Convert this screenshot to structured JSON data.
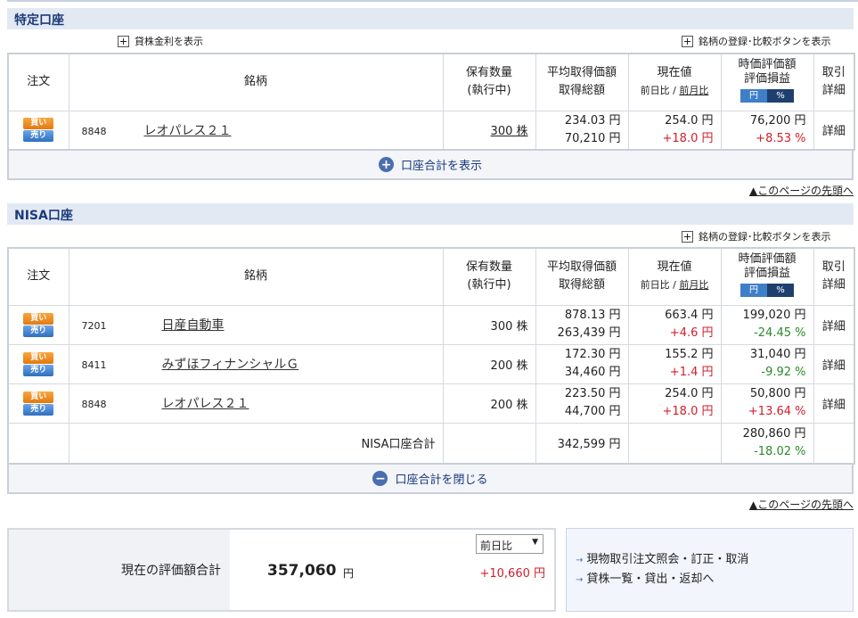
{
  "tokutei": {
    "title": "特定口座",
    "lend_link": "貸株金利を表示",
    "compare_link": "銘柄の登録･比較ボタンを表示",
    "rows": [
      {
        "code": "8848",
        "name": "レオパレス２１",
        "qty": "300 株",
        "avg": "234.03 円",
        "total": "70,210 円",
        "price": "254.0 円",
        "chg": "+18.0 円",
        "val": "76,200 円",
        "pl": "+8.53 %",
        "detail": "詳細"
      }
    ],
    "toggle": "口座合計を表示",
    "pagetop": "▲このページの先頭へ"
  },
  "headers": {
    "order": "注文",
    "name": "銘柄",
    "qty1": "保有数量",
    "qty2": "(執行中)",
    "avg1": "平均取得価額",
    "avg2": "取得総額",
    "price1": "現在値",
    "price2a": "前日比",
    "sep": "/",
    "price2b": "前月比",
    "val1": "時価評価額",
    "val2": "評価損益",
    "yen": "円",
    "pct": "%",
    "det1": "取引",
    "det2": "詳細",
    "buy": "買い",
    "sell": "売り"
  },
  "nisa": {
    "title": "NISA口座",
    "compare_link": "銘柄の登録･比較ボタンを表示",
    "rows": [
      {
        "code": "7201",
        "name": "日産自動車",
        "qty": "300 株",
        "avg": "878.13 円",
        "total": "263,439 円",
        "price": "663.4 円",
        "chg": "+4.6 円",
        "val": "199,020 円",
        "pl": "-24.45 %",
        "detail": "詳細"
      },
      {
        "code": "8411",
        "name": "みずほフィナンシャルＧ",
        "qty": "200 株",
        "avg": "172.30 円",
        "total": "34,460 円",
        "price": "155.2 円",
        "chg": "+1.4 円",
        "val": "31,040 円",
        "pl": "-9.92 %",
        "detail": "詳細"
      },
      {
        "code": "8848",
        "name": "レオパレス２１",
        "qty": "200 株",
        "avg": "223.50 円",
        "total": "44,700 円",
        "price": "254.0 円",
        "chg": "+18.0 円",
        "val": "50,800 円",
        "pl": "+13.64 %",
        "detail": "詳細"
      }
    ],
    "total_label": "NISA口座合計",
    "total_cost": "342,599 円",
    "total_val": "280,860 円",
    "total_pl": "-18.02 %",
    "toggle": "口座合計を閉じる",
    "pagetop": "▲このページの先頭へ"
  },
  "summary": {
    "label": "現在の評価額合計",
    "value": "357,060",
    "unit": "円",
    "select": "前日比",
    "change": "+10,660 円"
  },
  "links": [
    "現物取引注文照会・訂正・取消",
    "貸株一覧・貸出・返却へ"
  ],
  "colors": {
    "gain": "#d0202a",
    "loss": "#2a8a2a",
    "header_bg": "#e3e9f3"
  }
}
